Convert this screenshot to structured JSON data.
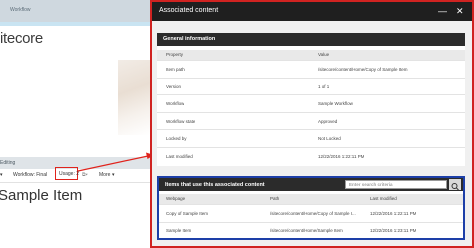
{
  "editor": {
    "topbar_label": "Workflow",
    "logo_text": "itecore",
    "ribbon_header": "Editing",
    "workflow_label": "Workflow: Final",
    "usage_label": "Usage: 2",
    "more_label": "More",
    "item_title": "Sample Item"
  },
  "panel": {
    "title": "Associated content",
    "minimize_icon": "minimize-icon",
    "close_icon": "close-icon",
    "general": {
      "heading": "General information",
      "columns": [
        "Property",
        "Value"
      ],
      "rows": [
        {
          "property": "Item path",
          "value": "/sitecore/content/Home/Copy of Sample Item"
        },
        {
          "property": "Version",
          "value": "1 of 1"
        },
        {
          "property": "Workflow",
          "value": "Sample Workflow"
        },
        {
          "property": "Workflow state",
          "value": "Approved"
        },
        {
          "property": "Locked by",
          "value": "Not Locked"
        },
        {
          "property": "Last modified",
          "value": "12/22/2016 1:22:11 PM"
        }
      ]
    },
    "usage": {
      "heading": "Items that use this associated content",
      "search_placeholder": "Enter search criteria",
      "columns": [
        "Webpage",
        "Path",
        "Last modified"
      ],
      "rows": [
        {
          "webpage": "Copy of Sample Item",
          "path": "/sitecore/content/Home/Copy of Sample I...",
          "modified": "12/22/2016 1:22:11 PM"
        },
        {
          "webpage": "Sample Item",
          "path": "/sitecore/content/Home/Sample Item",
          "modified": "12/22/2016 1:23:11 PM"
        }
      ]
    }
  },
  "colors": {
    "highlight_red": "#e0231c",
    "highlight_blue": "#1d3fa8",
    "panel_header": "#1f1f1f"
  }
}
